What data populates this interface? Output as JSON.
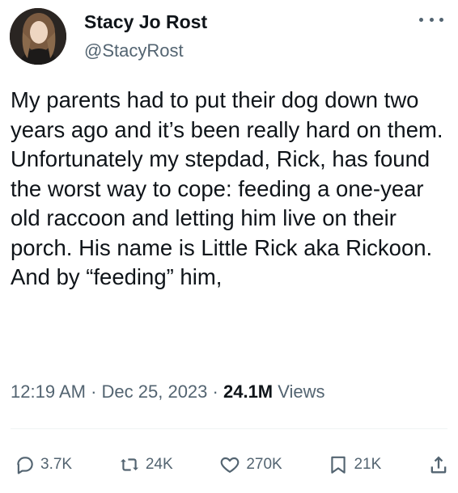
{
  "author": {
    "display_name": "Stacy Jo Rost",
    "handle": "@StacyRost"
  },
  "tweet": {
    "text": "My parents had to put their dog down two years ago and it’s been really hard on them. Unfortunately my stepdad, Rick, has found the worst way to cope: feeding a one-year old raccoon and letting him live on their porch. His name is Little Rick aka Rickoon. And by “feeding” him,",
    "time": "12:19 AM",
    "separator": "·",
    "date": "Dec 25, 2023",
    "views_count": "24.1M",
    "views_label": "Views"
  },
  "actions": {
    "replies": "3.7K",
    "reposts": "24K",
    "likes": "270K",
    "bookmarks": "21K"
  },
  "colors": {
    "text": "#0f1419",
    "secondary": "#536471",
    "divider": "#eff3f4"
  },
  "icons": [
    "more-icon",
    "reply-icon",
    "repost-icon",
    "like-icon",
    "bookmark-icon",
    "share-icon"
  ]
}
